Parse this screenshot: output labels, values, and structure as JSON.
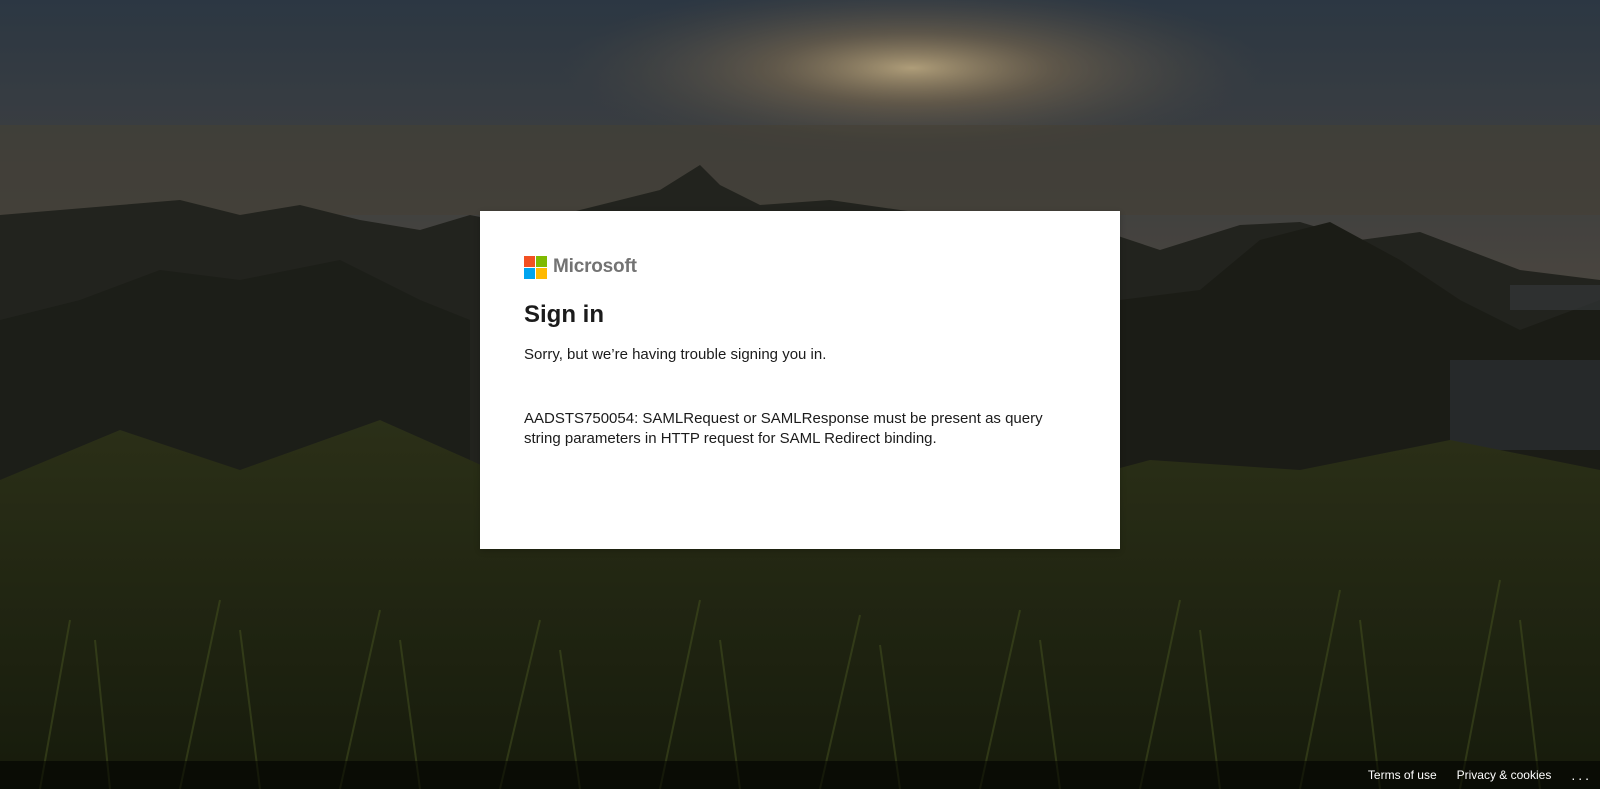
{
  "brand": {
    "name": "Microsoft",
    "logo_colors": [
      "#f25022",
      "#7fba00",
      "#00a4ef",
      "#ffb900"
    ]
  },
  "signin": {
    "title": "Sign in",
    "message": "Sorry, but we’re having trouble signing you in.",
    "error_detail": "AADSTS750054: SAMLRequest or SAMLResponse must be present as query string parameters in HTTP request for SAML Redirect binding."
  },
  "footer": {
    "terms_label": "Terms of use",
    "privacy_label": "Privacy & cookies",
    "more_label": "..."
  }
}
